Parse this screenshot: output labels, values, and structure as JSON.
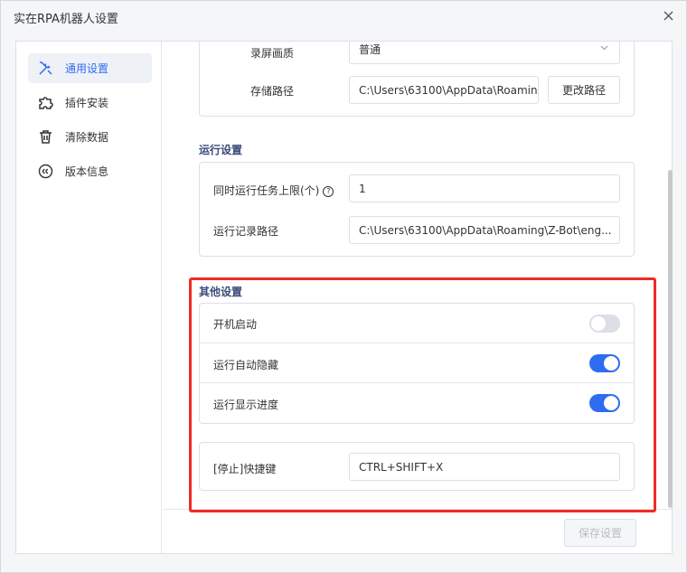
{
  "window": {
    "title": "实在RPA机器人设置"
  },
  "sidebar": {
    "items": [
      {
        "label": "通用设置",
        "icon": "tools-icon",
        "active": true
      },
      {
        "label": "插件安装",
        "icon": "puzzle-icon",
        "active": false
      },
      {
        "label": "清除数据",
        "icon": "trash-icon",
        "active": false
      },
      {
        "label": "版本信息",
        "icon": "copyright-icon",
        "active": false
      }
    ]
  },
  "recording": {
    "quality_label": "录屏画质",
    "quality_value": "普通",
    "path_label": "存储路径",
    "path_value": "C:\\Users\\63100\\AppData\\Roaming",
    "change_path_button": "更改路径"
  },
  "run_settings": {
    "title": "运行设置",
    "max_tasks_label": "同时运行任务上限(个)",
    "max_tasks_value": "1",
    "log_path_label": "运行记录路径",
    "log_path_value": "C:\\Users\\63100\\AppData\\Roaming\\Z-Bot\\eng..."
  },
  "other_settings": {
    "title": "其他设置",
    "toggles": [
      {
        "label": "开机启动",
        "on": false
      },
      {
        "label": "运行自动隐藏",
        "on": true
      },
      {
        "label": "运行显示进度",
        "on": true
      }
    ],
    "hotkey_label": "[停止]快捷键",
    "hotkey_value": "CTRL+SHIFT+X"
  },
  "footer": {
    "save_button": "保存设置"
  },
  "colors": {
    "accent": "#2e6cf2",
    "highlight": "#ef2b25",
    "toggle_off": "#dcdfe6"
  }
}
